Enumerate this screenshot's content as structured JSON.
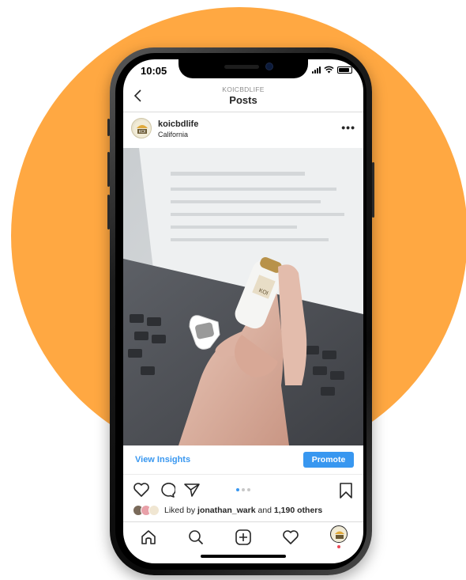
{
  "status_bar": {
    "time": "10:05"
  },
  "header": {
    "account": "KOICBDLIFE",
    "title": "Posts"
  },
  "post": {
    "username": "koicbdlife",
    "location": "California",
    "more": "•••",
    "photo_label": "KOI"
  },
  "insights": {
    "link": "View Insights",
    "promote": "Promote"
  },
  "likes": {
    "prefix": "Liked by ",
    "user": "jonathan_wark",
    "middle": " and ",
    "count": "1,190 others"
  },
  "carousel": {
    "current": 1,
    "total": 3
  },
  "tabbar": {
    "items": [
      "home-icon",
      "search-icon",
      "new-post-icon",
      "activity-icon",
      "profile-icon"
    ]
  },
  "colors": {
    "background_circle": "#FFA842",
    "accent": "#3897f0",
    "notification": "#ed4956"
  }
}
